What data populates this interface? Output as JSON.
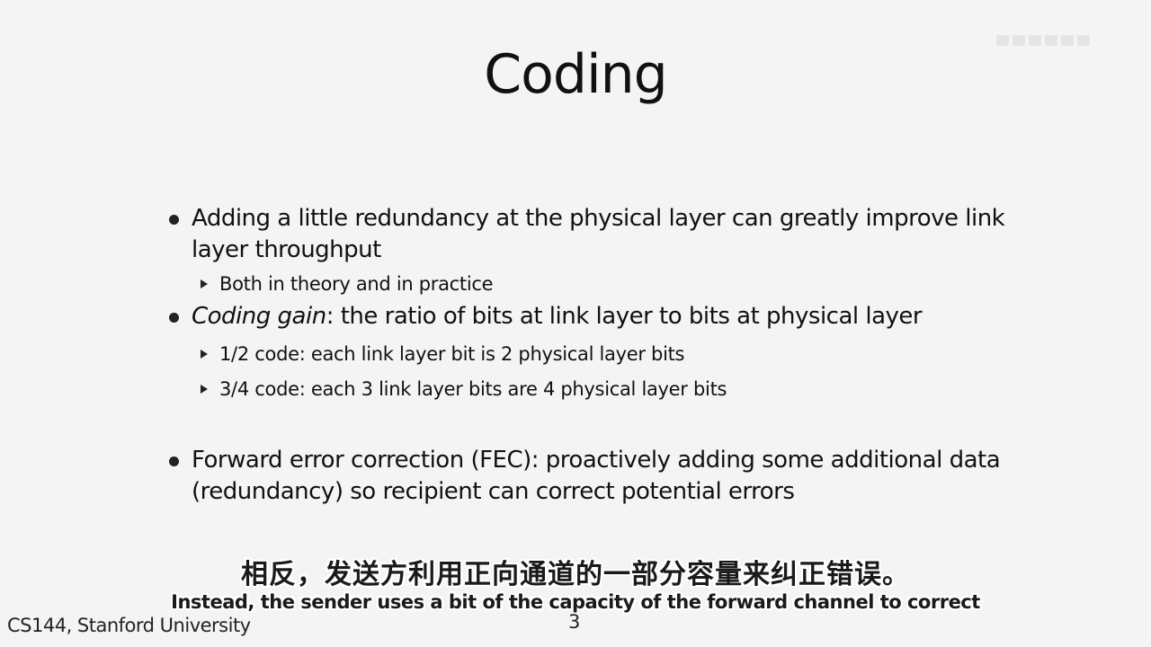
{
  "slide": {
    "title": "Coding",
    "bullets": [
      {
        "text": "Adding a little redundancy at the physical layer can greatly improve link layer throughput",
        "subs": [
          "Both in theory and in practice"
        ]
      },
      {
        "em": "Coding gain",
        "text": ": the ratio of bits at link layer to bits at physical layer",
        "subs": [
          "1/2 code: each link layer bit is 2 physical layer bits",
          "3/4 code: each 3 link layer bits are 4 physical layer bits"
        ]
      },
      {
        "text": "Forward error correction (FEC): proactively adding some additional data (redundancy) so recipient can correct potential errors"
      }
    ],
    "footer": "CS144, Stanford University",
    "page_number": "3"
  },
  "subtitles": {
    "zh": "相反，发送方利用正向通道的一部分容量来纠正错误。",
    "en": "Instead, the sender uses a bit of the capacity of the forward channel to correct"
  }
}
